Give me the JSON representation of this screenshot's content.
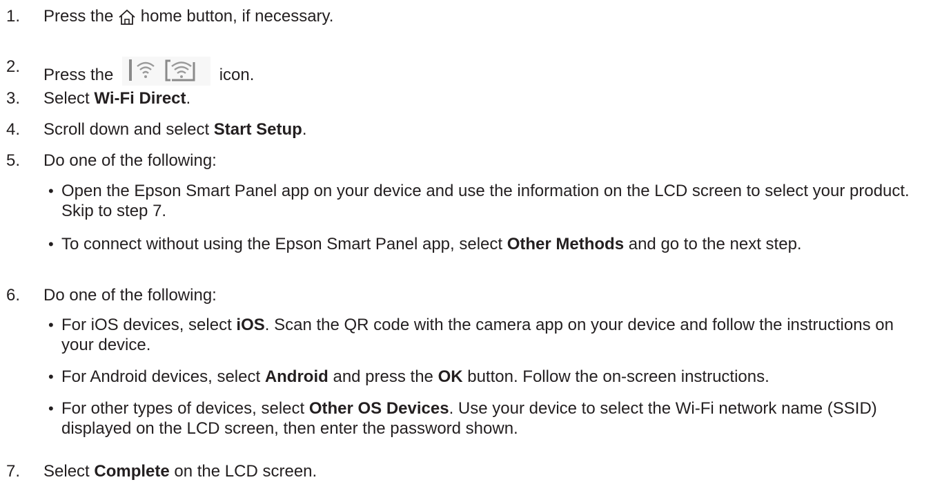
{
  "steps": [
    {
      "num": "1.",
      "parts": [
        "Press the ",
        " home button, if necessary."
      ]
    },
    {
      "num": "2.",
      "parts": [
        "Press the ",
        " icon."
      ]
    },
    {
      "num": "3.",
      "parts": [
        "Select ",
        "Wi-Fi Direct",
        "."
      ]
    },
    {
      "num": "4.",
      "parts": [
        "Scroll down and select ",
        "Start Setup",
        "."
      ]
    },
    {
      "num": "5.",
      "parts": [
        "Do one of the following:"
      ],
      "bullets": [
        {
          "parts": [
            "Open the Epson Smart Panel app on your device and use the information on the LCD screen to select your product. Skip to step 7."
          ]
        },
        {
          "parts": [
            "To connect without using the Epson Smart Panel app, select ",
            "Other Methods",
            " and go to the next step."
          ]
        }
      ]
    },
    {
      "num": "6.",
      "parts": [
        "Do one of the following:"
      ],
      "bullets": [
        {
          "parts": [
            "For iOS devices, select ",
            "iOS",
            ". Scan the QR code with the camera app on your device and follow the instructions on your device."
          ]
        },
        {
          "parts": [
            "For Android devices, select ",
            "Android",
            " and press the ",
            "OK",
            " button. Follow the on-screen instructions."
          ]
        },
        {
          "parts": [
            "For other types of devices, select ",
            "Other OS Devices",
            ". Use your device to select the Wi-Fi network name (SSID) displayed on the LCD screen, then enter the password shown."
          ]
        }
      ]
    },
    {
      "num": "7.",
      "parts": [
        "Select ",
        "Complete",
        " on the LCD screen."
      ]
    }
  ],
  "bullet_char": "•",
  "icons": {
    "home": "home-icon",
    "wifi": "wifi-status-icons"
  },
  "colors": {
    "text": "#231f20",
    "icon_gray": "#8a8a8a",
    "icon_bg": "#f2f2f2"
  }
}
